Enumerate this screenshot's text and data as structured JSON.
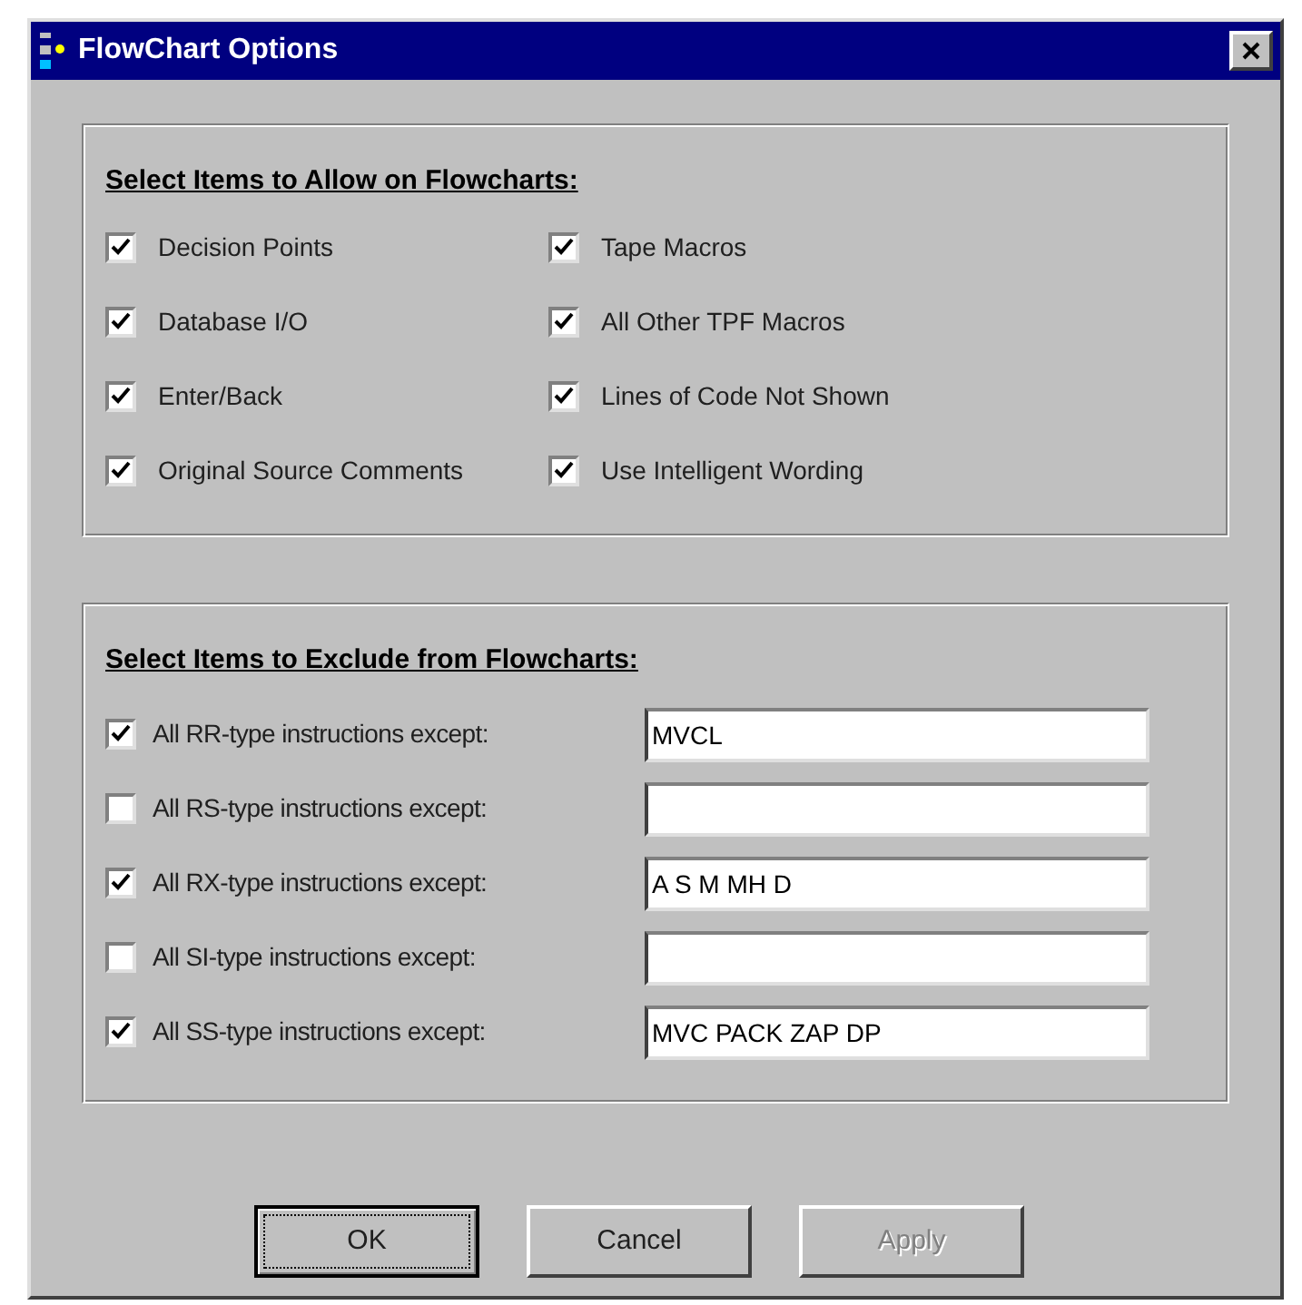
{
  "window": {
    "title": "FlowChart Options"
  },
  "allow_group": {
    "heading": "Select Items to Allow on Flowcharts:",
    "items": [
      {
        "label": "Decision Points",
        "checked": true
      },
      {
        "label": "Database I/O",
        "checked": true
      },
      {
        "label": "Enter/Back",
        "checked": true
      },
      {
        "label": "Original Source Comments",
        "checked": true
      },
      {
        "label": "Tape Macros",
        "checked": true
      },
      {
        "label": "All Other TPF Macros",
        "checked": true
      },
      {
        "label": "Lines of Code Not Shown",
        "checked": true
      },
      {
        "label": "Use Intelligent Wording",
        "checked": true
      }
    ]
  },
  "exclude_group": {
    "heading": "Select Items to Exclude from Flowcharts:",
    "items": [
      {
        "label": "All RR-type instructions except:",
        "checked": true,
        "value": "MVCL"
      },
      {
        "label": "All RS-type instructions except:",
        "checked": false
      },
      {
        "label": "All RX-type instructions except:",
        "checked": true,
        "value": "A S M MH D"
      },
      {
        "label": "All SI-type instructions except:",
        "checked": false
      },
      {
        "label": "All SS-type instructions except:",
        "checked": true,
        "value": "MVC PACK ZAP DP"
      }
    ]
  },
  "buttons": [
    {
      "label": "OK",
      "default": true,
      "disabled": false
    },
    {
      "label": "Cancel",
      "default": false,
      "disabled": false
    },
    {
      "label": "Apply",
      "default": false,
      "disabled": true
    }
  ]
}
